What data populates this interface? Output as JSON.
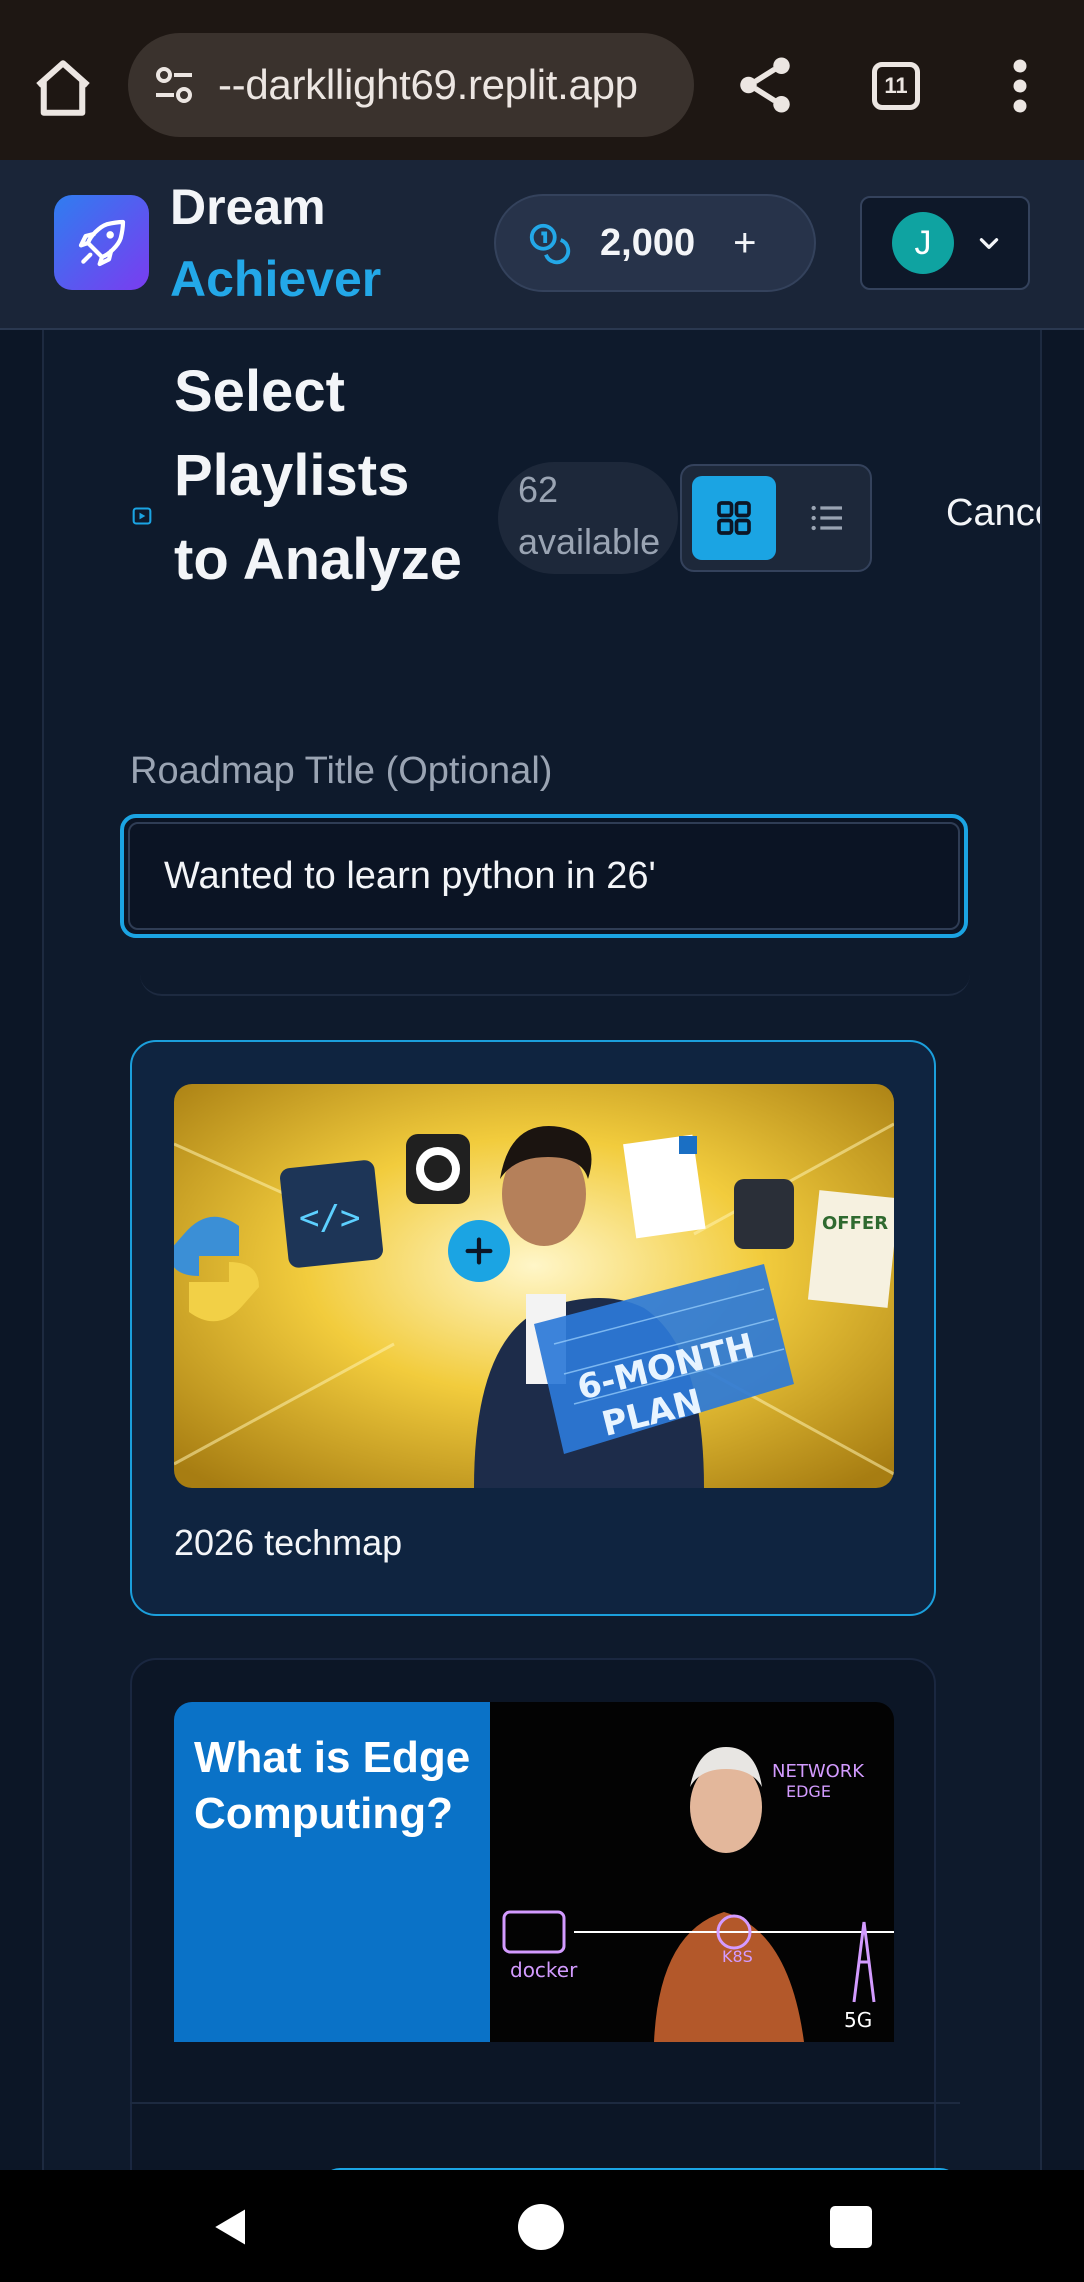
{
  "browser": {
    "url": "--darkllight69.replit.app",
    "tab_count": "11"
  },
  "header": {
    "brand_line1": "Dream",
    "brand_line2": "Achiever",
    "credits": "2,000",
    "credits_add": "+",
    "user_initial": "J"
  },
  "selector": {
    "title": "Select Playlists to Analyze",
    "available": "62 available",
    "cancel_label": "Cancel",
    "active_view": "grid"
  },
  "roadmap": {
    "label": "Roadmap Title (Optional)",
    "value": "Wanted to learn python in 26'"
  },
  "playlists": [
    {
      "title": "2026 techmap",
      "selected": true,
      "thumbnail_text": "6-MONTH PLAN"
    },
    {
      "title": "",
      "selected": false,
      "thumbnail_text": "What is Edge Computing?"
    }
  ],
  "colors": {
    "accent": "#1ba4e3",
    "background": "#0c1626",
    "header": "#1a2538",
    "avatar": "#0fa3a1"
  }
}
